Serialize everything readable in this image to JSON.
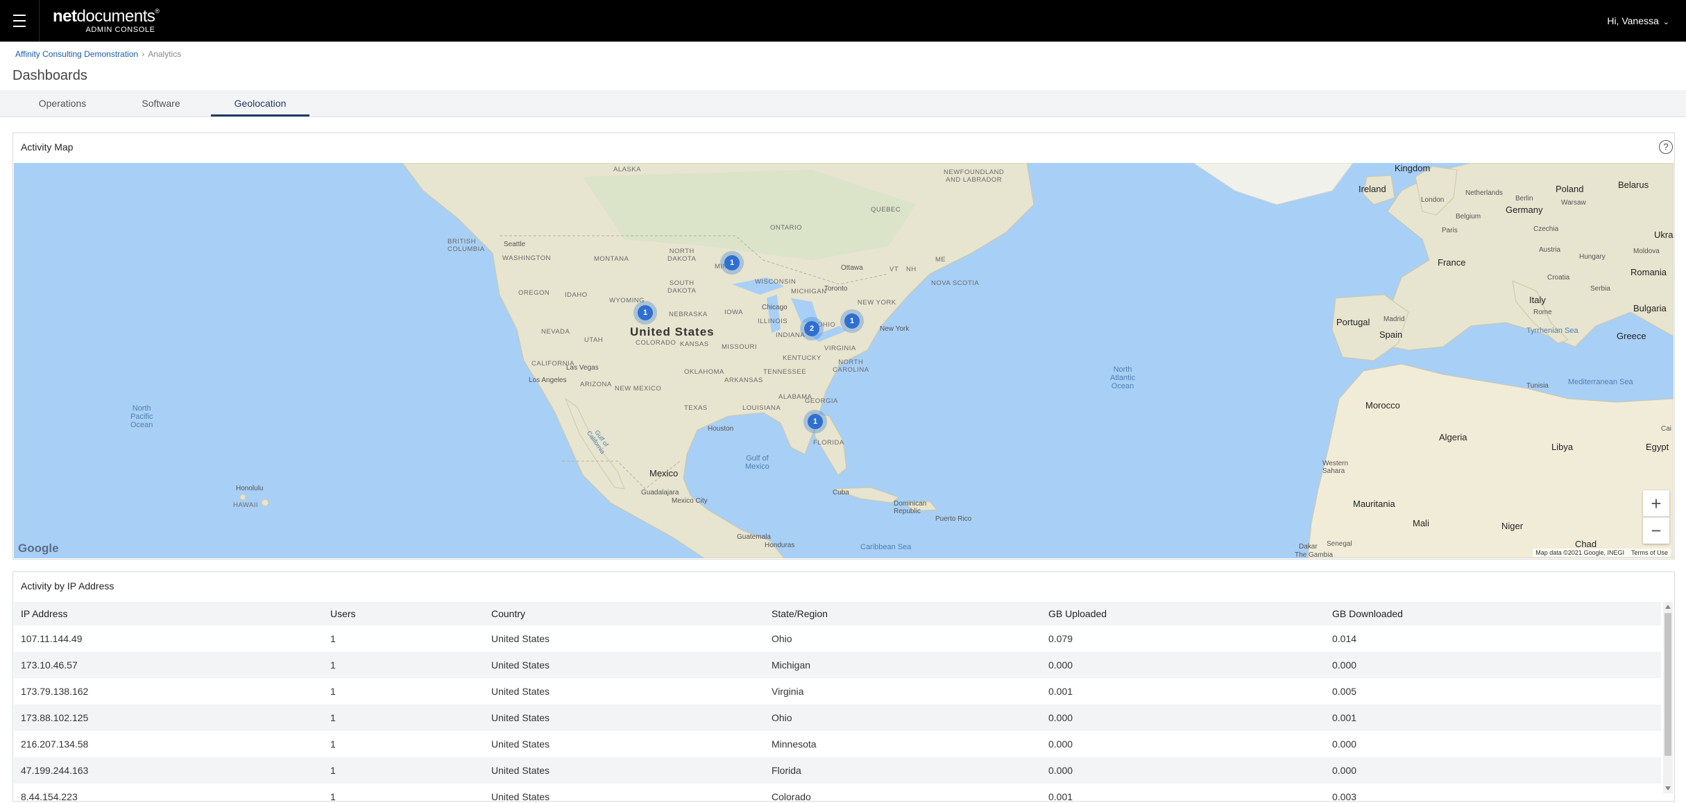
{
  "header": {
    "logo_net": "net",
    "logo_documents": "documents",
    "logo_mark": "®",
    "logo_sub": "ADMIN CONSOLE",
    "greeting": "Hi, Vanessa",
    "chevron": "⌄"
  },
  "breadcrumb": {
    "items": [
      "Affinity Consulting Demonstration",
      "Analytics"
    ],
    "separator": "›"
  },
  "page_title": "Dashboards",
  "tabs": [
    {
      "label": "Operations",
      "active": false
    },
    {
      "label": "Software",
      "active": false
    },
    {
      "label": "Geolocation",
      "active": true
    }
  ],
  "activity_map": {
    "title": "Activity Map",
    "help_icon": "?",
    "clusters": [
      {
        "count": "1",
        "region": "Minnesota"
      },
      {
        "count": "1",
        "region": "Colorado"
      },
      {
        "count": "2",
        "region": "Ohio"
      },
      {
        "count": "1",
        "region": "Virginia"
      },
      {
        "count": "1",
        "region": "Florida"
      }
    ],
    "labels": {
      "united_states": "United States",
      "mexico": "Mexico",
      "north_pacific": "North\nPacific\nOcean",
      "north_atlantic": "North\nAtlantic\nOcean",
      "gulf_of_mexico": "Gulf of\nMexico",
      "caribbean": "Caribbean Sea",
      "cuba": "Cuba",
      "dominican": "Dominican\nRepublic",
      "puerto_rico": "Puerto Rico",
      "guatemala": "Guatemala",
      "honduras": "Honduras",
      "hawaii": "HAWAII",
      "honolulu": "Honolulu",
      "alaska": "ALASKA",
      "newfoundland": "NEWFOUNDLAND\nAND LABRADOR",
      "quebec": "QUEBEC",
      "ontario": "ONTARIO",
      "british_columbia": "BRITISH\nCOLUMBIA",
      "seattle": "Seattle",
      "washington": "WASHINGTON",
      "montana": "MONTANA",
      "north_dakota": "NORTH\nDAKOTA",
      "south_dakota": "SOUTH\nDAKOTA",
      "minnesota": "MINN",
      "wisconsin": "WISCONSIN",
      "michigan": "MICHIGAN",
      "oregon": "OREGON",
      "idaho": "IDAHO",
      "wyoming": "WYOMING",
      "nebraska": "NEBRASKA",
      "iowa": "IOWA",
      "illinois": "ILLINOIS",
      "indiana": "INDIANA",
      "ohio": "OHIO",
      "nevada": "NEVADA",
      "utah": "UTAH",
      "colorado": "COLORADO",
      "kansas": "KANSAS",
      "missouri": "MISSOURI",
      "kentucky": "KENTUCKY",
      "virginia": "VIRGINIA",
      "california": "CALIFORNIA",
      "las_vegas": "Las Vegas",
      "los_angeles": "Los Angeles",
      "arizona": "ARIZONA",
      "new_mexico": "NEW MEXICO",
      "oklahoma": "OKLAHOMA",
      "arkansas": "ARKANSAS",
      "tennessee": "TENNESSEE",
      "north_carolina": "NORTH\nCAROLINA",
      "texas": "TEXAS",
      "houston": "Houston",
      "louisiana": "LOUISIANA",
      "alabama": "ALABAMA",
      "georgia": "GEORGIA",
      "florida": "FLORIDA",
      "chicago": "Chicago",
      "toronto": "Toronto",
      "ottawa": "Ottawa",
      "new_york": "New York",
      "new_york_state": "NEW YORK",
      "nova_scotia": "NOVA SCOTIA",
      "vermont": "VT",
      "new_hampshire": "NH",
      "maine": "ME",
      "guadalajara": "Guadalajara",
      "mexico_city": "Mexico City",
      "gulf_of_california": "Gulf of\nCalifornia",
      "kingdom": "Kingdom",
      "ireland": "Ireland",
      "london": "London",
      "netherlands": "Netherlands",
      "berlin": "Berlin",
      "germany": "Germany",
      "poland": "Poland",
      "warsaw": "Warsaw",
      "belarus": "Belarus",
      "belgium": "Belgium",
      "paris": "Paris",
      "czechia": "Czechia",
      "ukraine": "Ukra",
      "france": "France",
      "austria": "Austria",
      "hungary": "Hungary",
      "moldova": "Moldova",
      "croatia": "Croatia",
      "romania": "Romania",
      "serbia": "Serbia",
      "italy": "Italy",
      "rome": "Rome",
      "bulgaria": "Bulgaria",
      "portugal": "Portugal",
      "madrid": "Madrid",
      "spain": "Spain",
      "tyrrhenian": "Tyrrhenian Sea",
      "greece": "Greece",
      "tunisia": "Tunisia",
      "mediterranean": "Mediterranean Sea",
      "morocco": "Morocco",
      "algeria": "Algeria",
      "libya": "Libya",
      "egypt": "Egypt",
      "cairo": "Cai",
      "western_sahara": "Western\nSahara",
      "mauritania": "Mauritania",
      "mali": "Mali",
      "niger": "Niger",
      "chad": "Chad",
      "senegal": "Senegal",
      "dakar": "Dakar",
      "gambia": "The Gambia"
    },
    "zoom_in": "+",
    "zoom_out": "−",
    "google": "Google",
    "map_data": "Map data ©2021 Google, INEGI",
    "terms": "Terms of Use"
  },
  "ip_table": {
    "title": "Activity by IP Address",
    "columns": [
      "IP Address",
      "Users",
      "Country",
      "State/Region",
      "GB Uploaded",
      "GB Downloaded"
    ],
    "rows": [
      [
        "107.11.144.49",
        "1",
        "United States",
        "Ohio",
        "0.079",
        "0.014"
      ],
      [
        "173.10.46.57",
        "1",
        "United States",
        "Michigan",
        "0.000",
        "0.000"
      ],
      [
        "173.79.138.162",
        "1",
        "United States",
        "Virginia",
        "0.001",
        "0.005"
      ],
      [
        "173.88.102.125",
        "1",
        "United States",
        "Ohio",
        "0.000",
        "0.001"
      ],
      [
        "216.207.134.58",
        "1",
        "United States",
        "Minnesota",
        "0.000",
        "0.000"
      ],
      [
        "47.199.244.163",
        "1",
        "United States",
        "Florida",
        "0.000",
        "0.000"
      ],
      [
        "8.44.154.223",
        "1",
        "United States",
        "Colorado",
        "0.001",
        "0.003"
      ]
    ]
  },
  "colors": {
    "topbar": "#000000",
    "accent": "#1f3b63",
    "link": "#1a5ea8",
    "water": "#a8cff5",
    "land": "#e9e5d3",
    "cluster": "#2f6fd0"
  }
}
